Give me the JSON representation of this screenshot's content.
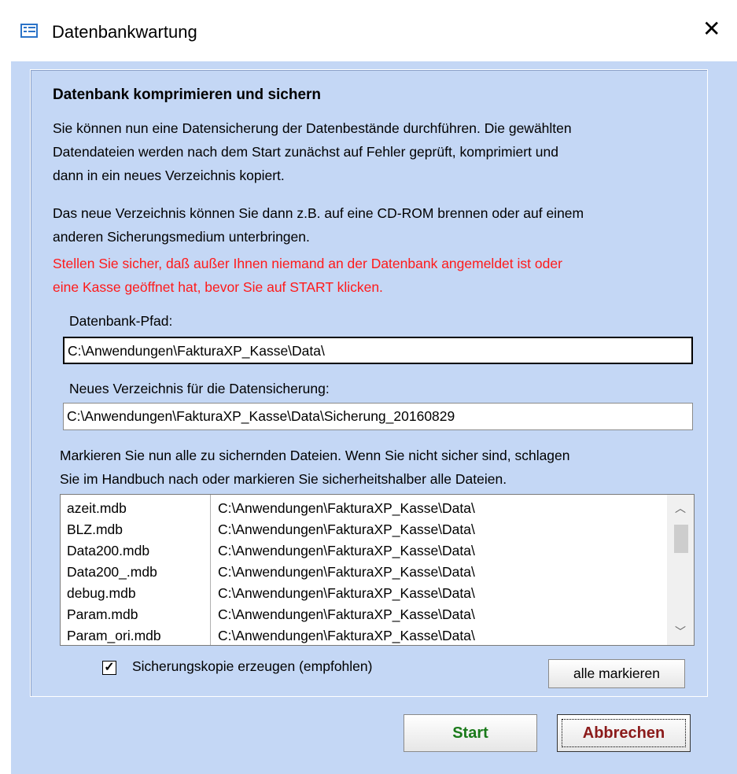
{
  "window": {
    "title": "Datenbankwartung",
    "close_glyph": "✕",
    "icon": "form-icon"
  },
  "section": {
    "heading": "Datenbank komprimieren und sichern",
    "intro_lines": [
      "Sie können nun eine Datensicherung der Datenbestände durchführen. Die gewählten",
      "Datendateien werden nach dem Start zunächst auf Fehler geprüft, komprimiert und",
      "dann in ein neues Verzeichnis kopiert."
    ],
    "info_lines": [
      "Das neue Verzeichnis können Sie dann z.B. auf eine CD-ROM brennen oder auf einem",
      "anderen Sicherungsmedium unterbringen."
    ],
    "warning_lines": [
      "Stellen Sie sicher, daß außer Ihnen niemand an der Datenbank angemeldet ist oder",
      "eine Kasse geöffnet hat, bevor Sie auf START klicken."
    ],
    "warning_color": "#ff1a1a"
  },
  "db_path": {
    "label": "Datenbank-Pfad:",
    "value": "C:\\Anwendungen\\FakturaXP_Kasse\\Data\\"
  },
  "backup_dir": {
    "label": "Neues Verzeichnis für die Datensicherung:",
    "value": "C:\\Anwendungen\\FakturaXP_Kasse\\Data\\Sicherung_20160829"
  },
  "files_hint_lines": [
    "Markieren Sie nun alle zu sichernden Dateien. Wenn Sie nicht sicher sind, schlagen",
    "Sie im Handbuch nach oder markieren Sie sicherheitshalber alle Dateien."
  ],
  "files": [
    {
      "name": "azeit.mdb",
      "path": "C:\\Anwendungen\\FakturaXP_Kasse\\Data\\"
    },
    {
      "name": "BLZ.mdb",
      "path": "C:\\Anwendungen\\FakturaXP_Kasse\\Data\\"
    },
    {
      "name": "Data200.mdb",
      "path": "C:\\Anwendungen\\FakturaXP_Kasse\\Data\\"
    },
    {
      "name": "Data200_.mdb",
      "path": "C:\\Anwendungen\\FakturaXP_Kasse\\Data\\"
    },
    {
      "name": "debug.mdb",
      "path": "C:\\Anwendungen\\FakturaXP_Kasse\\Data\\"
    },
    {
      "name": "Param.mdb",
      "path": "C:\\Anwendungen\\FakturaXP_Kasse\\Data\\"
    },
    {
      "name": "Param_ori.mdb",
      "path": "C:\\Anwendungen\\FakturaXP_Kasse\\Data\\"
    }
  ],
  "scrollbar": {
    "up_glyph": "︿",
    "down_glyph": "﹀"
  },
  "backup_copy": {
    "label": "Sicherungskopie erzeugen (empfohlen)",
    "checked": true,
    "check_glyph": "✓"
  },
  "buttons": {
    "mark_all": "alle markieren",
    "start": "Start",
    "cancel": "Abbrechen"
  },
  "colors": {
    "dialog_bg": "#c4d7f5",
    "start_text": "#1a7a1a",
    "cancel_text": "#8b1a1a"
  }
}
